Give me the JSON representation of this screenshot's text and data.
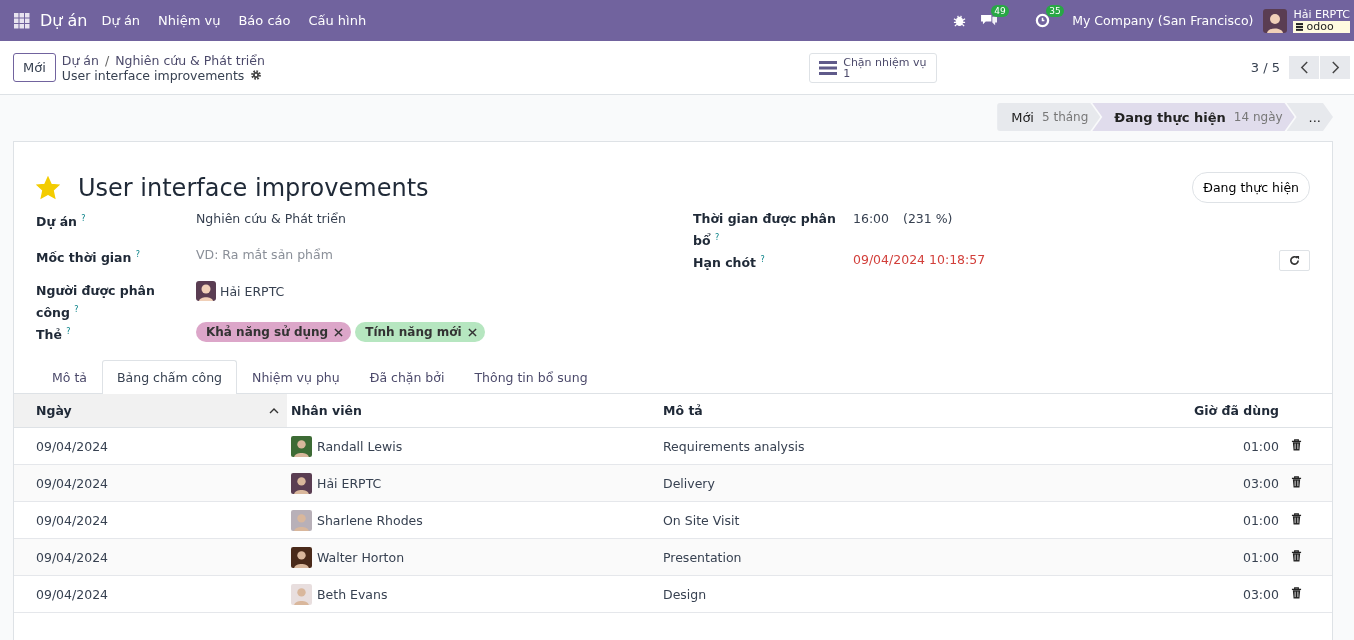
{
  "navbar": {
    "app_name": "Dự án",
    "menu": [
      "Dự án",
      "Nhiệm vụ",
      "Báo cáo",
      "Cấu hình"
    ],
    "messages_count": "49",
    "activities_count": "35",
    "company": "My Company (San Francisco)",
    "user": "Hải ERPTC",
    "database": "odoo"
  },
  "control_panel": {
    "new_button": "Mới",
    "breadcrumbs": [
      "Dự án",
      "Nghiên cứu & Phát triển"
    ],
    "breadcrumb_separator": "/",
    "record_name": "User interface improvements",
    "smart_button": {
      "label": "Chặn nhiệm vụ",
      "count": "1"
    },
    "pager": "3 / 5"
  },
  "stages": [
    {
      "label": "Mới",
      "duration": "5 tháng",
      "selected": false
    },
    {
      "label": "Đang thực hiện",
      "duration": "14 ngày",
      "selected": true
    },
    {
      "label": "...",
      "selected": false
    }
  ],
  "task": {
    "favorite": true,
    "title": "User interface improvements",
    "state_button": "Đang thực hiện"
  },
  "fields_left": [
    {
      "kind": "text",
      "label": "Dự án $^{?}$",
      "value": "Nghiên cứu & Phát triển"
    },
    {
      "kind": "placeholder",
      "label": "Mốc thời gian $^{?}$",
      "placeholder": "VD: Ra mắt sản phẩm"
    },
    {
      "kind": "user",
      "label": "Người được phân công $^{?}$",
      "value": "Hải ERPTC"
    },
    {
      "kind": "tags",
      "label": "Thẻ $^{?}$",
      "tags": [
        {
          "label": "Khả năng sử dụng",
          "color": "#dca6c9"
        },
        {
          "label": "Tính năng mới",
          "color": "#b6e6c0"
        }
      ]
    }
  ],
  "fields_right": [
    {
      "kind": "hours",
      "label": "Thời gian được phân bổ $^{?}$",
      "value": "16:00",
      "percent": "(231 %)"
    },
    {
      "kind": "deadline",
      "label": "Hạn chót $^{?}$",
      "value": "09/04/2024 10:18:57",
      "overdue": true
    }
  ],
  "tabs": [
    {
      "label": "Mô tả",
      "selected": false
    },
    {
      "label": "Bảng chấm công",
      "selected": true
    },
    {
      "label": "Nhiệm vụ phụ",
      "selected": false
    },
    {
      "label": "Đã chặn bởi",
      "selected": false
    },
    {
      "label": "Thông tin bổ sung",
      "selected": false
    }
  ],
  "timesheet": {
    "columns": [
      {
        "label": "Ngày",
        "sort_ascending": true
      },
      {
        "label": "Nhân viên"
      },
      {
        "label": "Mô tả"
      },
      {
        "label": "Giờ đã dùng"
      }
    ],
    "rows": [
      {
        "date": "09/04/2024",
        "employee": "Randall Lewis",
        "description": "Requirements analysis",
        "hours": "01:00"
      },
      {
        "date": "09/04/2024",
        "employee": "Hải ERPTC",
        "description": "Delivery",
        "hours": "03:00"
      },
      {
        "date": "09/04/2024",
        "employee": "Sharlene Rhodes",
        "description": "On Site Visit",
        "hours": "01:00"
      },
      {
        "date": "09/04/2024",
        "employee": "Walter Horton",
        "description": "Presentation",
        "hours": "01:00"
      },
      {
        "date": "09/04/2024",
        "employee": "Beth Evans",
        "description": "Design",
        "hours": "03:00"
      }
    ]
  }
}
